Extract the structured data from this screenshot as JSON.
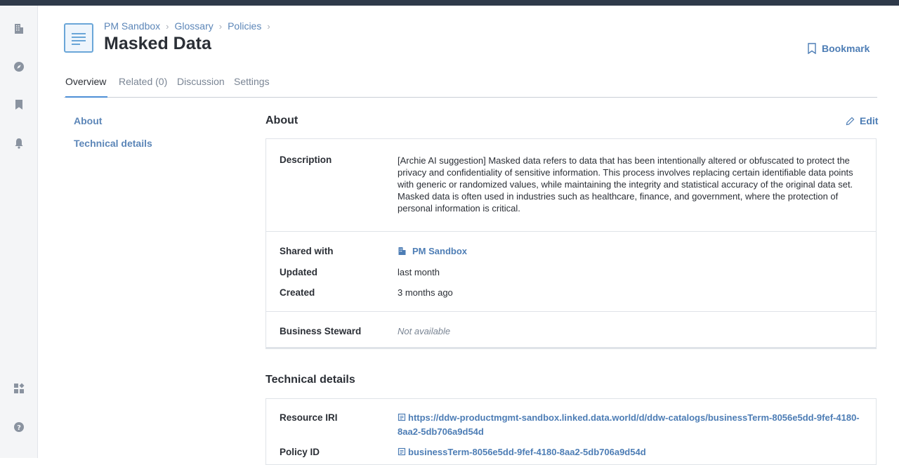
{
  "breadcrumb": [
    "PM Sandbox",
    "Glossary",
    "Policies"
  ],
  "title": "Masked Data",
  "bookmark_label": "Bookmark",
  "tabs": [
    {
      "label": "Overview",
      "active": true
    },
    {
      "label": "Related (0)",
      "active": false
    },
    {
      "label": "Discussion",
      "active": false
    },
    {
      "label": "Settings",
      "active": false
    }
  ],
  "side_nav": [
    "About",
    "Technical details"
  ],
  "about": {
    "heading": "About",
    "edit_label": "Edit",
    "description_label": "Description",
    "description": "[Archie AI suggestion] Masked data refers to data that has been intentionally altered or obfuscated to protect the privacy and confidentiality of sensitive information. This process involves replacing certain identifiable data points with generic or randomized values, while maintaining the integrity and statistical accuracy of the original data set. Masked data is often used in industries such as healthcare, finance, and government, where the protection of personal information is critical.",
    "shared_with_label": "Shared with",
    "shared_with": "PM Sandbox",
    "updated_label": "Updated",
    "updated": "last month",
    "created_label": "Created",
    "created": "3 months ago",
    "steward_label": "Business Steward",
    "steward": "Not available"
  },
  "technical": {
    "heading": "Technical details",
    "iri_label": "Resource IRI",
    "iri": "https://ddw-productmgmt-sandbox.linked.data.world/d/ddw-catalogs/businessTerm-8056e5dd-9fef-4180-8aa2-5db706a9d54d",
    "policy_id_label": "Policy ID",
    "policy_id": "businessTerm-8056e5dd-9fef-4180-8aa2-5db706a9d54d"
  },
  "rail_icons": [
    "building-icon",
    "compass-icon",
    "bookmark-icon",
    "bell-icon",
    "apps-icon",
    "help-icon"
  ],
  "colors": {
    "accent": "#4d7db5",
    "tab_underline": "#4d8fd6",
    "rail_bg": "#f4f5f7"
  }
}
